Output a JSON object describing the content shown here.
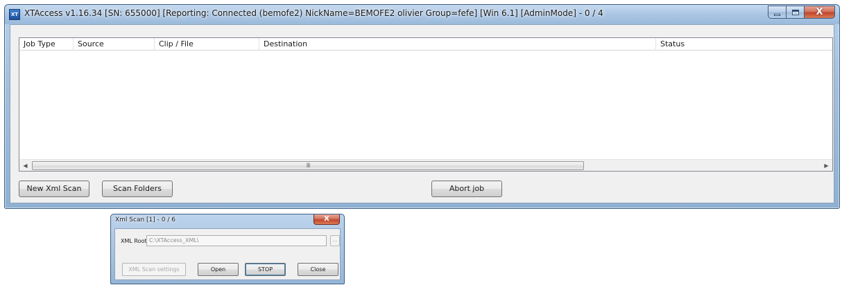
{
  "main_window": {
    "title": "XTAccess v1.16.34 [SN: 655000] [Reporting: Connected (bemofe2) NickName=BEMOFE2 olivier Group=fefe] [Win 6.1] [AdminMode] - 0 / 4",
    "icon": "app-icon",
    "controls": {
      "minimize": "minimize-icon",
      "maximize": "maximize-icon",
      "close": "close-icon",
      "close_glyph": "X"
    },
    "list": {
      "columns": [
        "Job Type",
        "Source",
        "Clip / File",
        "Destination",
        "Status"
      ],
      "rows": [],
      "scrollbar_grip": "III"
    },
    "buttons": {
      "new_xml_scan": "New Xml Scan",
      "scan_folders": "Scan Folders",
      "abort_job": "Abort job"
    }
  },
  "dialog": {
    "title": "Xml Scan [1] - 0 / 6",
    "close_glyph": "X",
    "xml_root_label": "XML Root:",
    "xml_root_value": "C:\\XTAccess_XML\\",
    "browse_label": "...",
    "buttons": {
      "scan_settings": "XML Scan settings",
      "open": "Open",
      "stop": "STOP",
      "close": "Close"
    }
  },
  "colors": {
    "title_bar": "#aac5e3",
    "client": "#f0f0f0",
    "close_button": "#c2452d"
  }
}
